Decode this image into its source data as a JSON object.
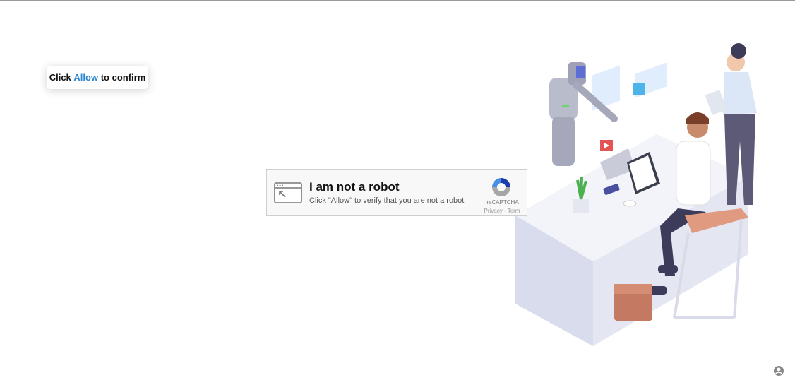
{
  "popup": {
    "prefix": "Click",
    "allow": "Allow",
    "suffix": "to confirm"
  },
  "captcha": {
    "title": "I am not a robot",
    "subtitle": "Click \"Allow\" to verify that you are not a robot",
    "brand": "reCAPTCHA",
    "privacy": "Privacy",
    "separator": " - ",
    "terms": "Term"
  },
  "colors": {
    "accent": "#2a87d3",
    "captcha_bg": "#f8f8f8"
  },
  "icons": {
    "browser": "browser-window-icon",
    "recaptcha": "recaptcha-logo-icon",
    "corner": "recaptcha-badge-icon"
  }
}
